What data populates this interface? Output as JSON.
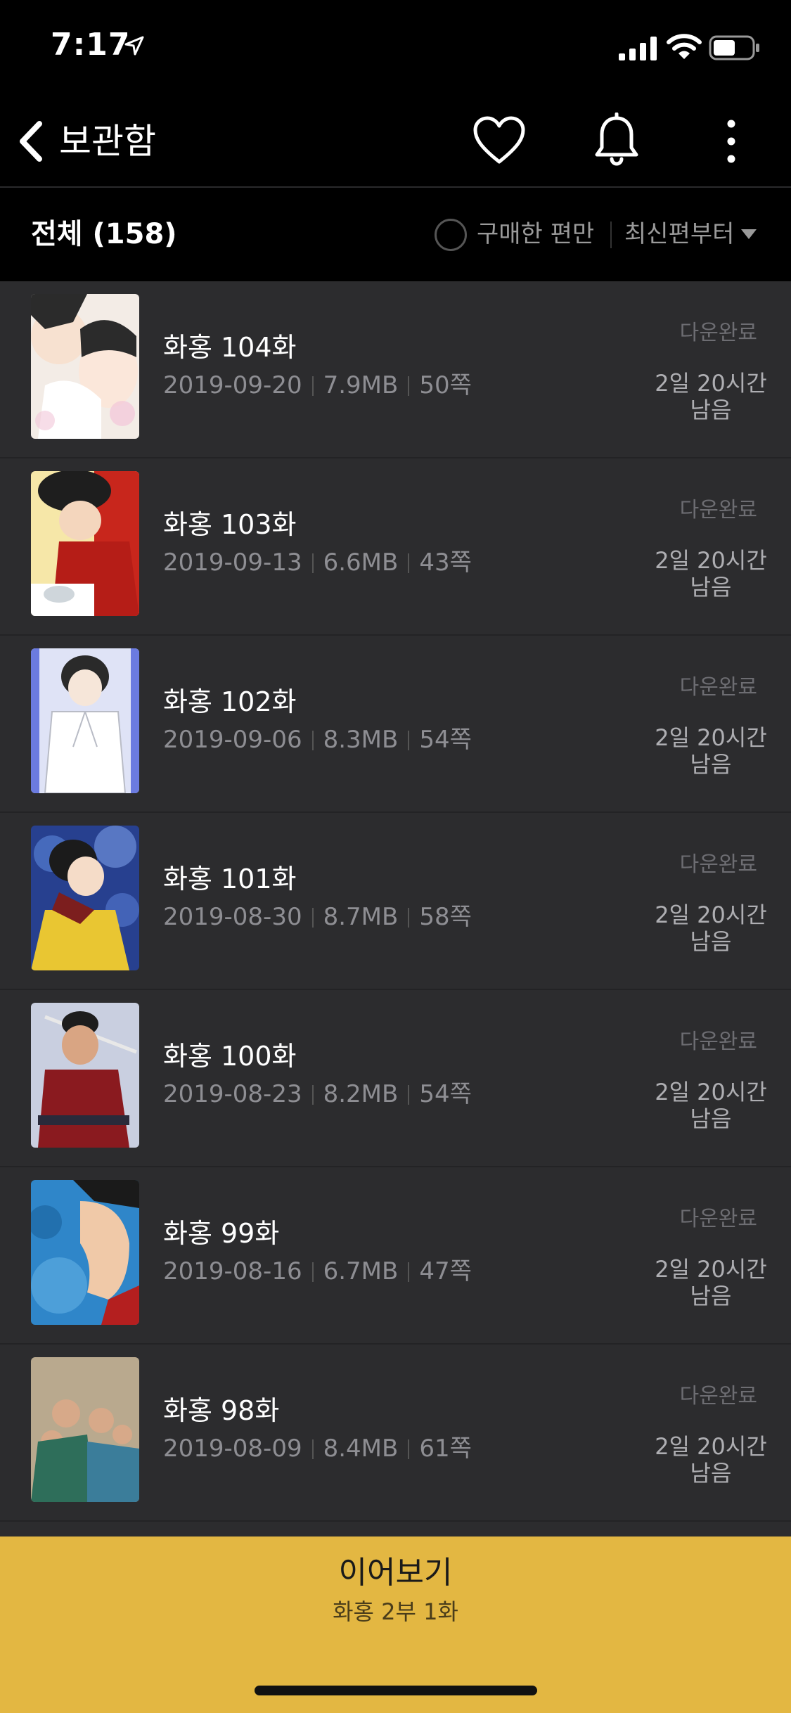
{
  "status_bar": {
    "time": "7:17"
  },
  "header": {
    "title": "보관함",
    "icons": [
      "back-icon",
      "heart-icon",
      "bell-icon",
      "more-icon"
    ]
  },
  "filter": {
    "count_label": "전체 (158)",
    "purchased_only_label": "구매한 편만",
    "sort_label": "최신편부터"
  },
  "episodes": [
    {
      "title": "화홍 104화",
      "date": "2019-09-20",
      "size": "7.9MB",
      "pages": "50쪽",
      "status": "다운완료",
      "remaining_line1": "2일 20시간",
      "remaining_line2": "남음"
    },
    {
      "title": "화홍 103화",
      "date": "2019-09-13",
      "size": "6.6MB",
      "pages": "43쪽",
      "status": "다운완료",
      "remaining_line1": "2일 20시간",
      "remaining_line2": "남음"
    },
    {
      "title": "화홍 102화",
      "date": "2019-09-06",
      "size": "8.3MB",
      "pages": "54쪽",
      "status": "다운완료",
      "remaining_line1": "2일 20시간",
      "remaining_line2": "남음"
    },
    {
      "title": "화홍 101화",
      "date": "2019-08-30",
      "size": "8.7MB",
      "pages": "58쪽",
      "status": "다운완료",
      "remaining_line1": "2일 20시간",
      "remaining_line2": "남음"
    },
    {
      "title": "화홍 100화",
      "date": "2019-08-23",
      "size": "8.2MB",
      "pages": "54쪽",
      "status": "다운완료",
      "remaining_line1": "2일 20시간",
      "remaining_line2": "남음"
    },
    {
      "title": "화홍 99화",
      "date": "2019-08-16",
      "size": "6.7MB",
      "pages": "47쪽",
      "status": "다운완료",
      "remaining_line1": "2일 20시간",
      "remaining_line2": "남음"
    },
    {
      "title": "화홍 98화",
      "date": "2019-08-09",
      "size": "8.4MB",
      "pages": "61쪽",
      "status": "다운완료",
      "remaining_line1": "2일 20시간",
      "remaining_line2": "남음"
    }
  ],
  "continue": {
    "label": "이어보기",
    "episode": "화홍 2부 1화"
  },
  "colors": {
    "accent": "#e3b742",
    "list_bg": "#2c2c2e",
    "header_bg": "#000000"
  }
}
